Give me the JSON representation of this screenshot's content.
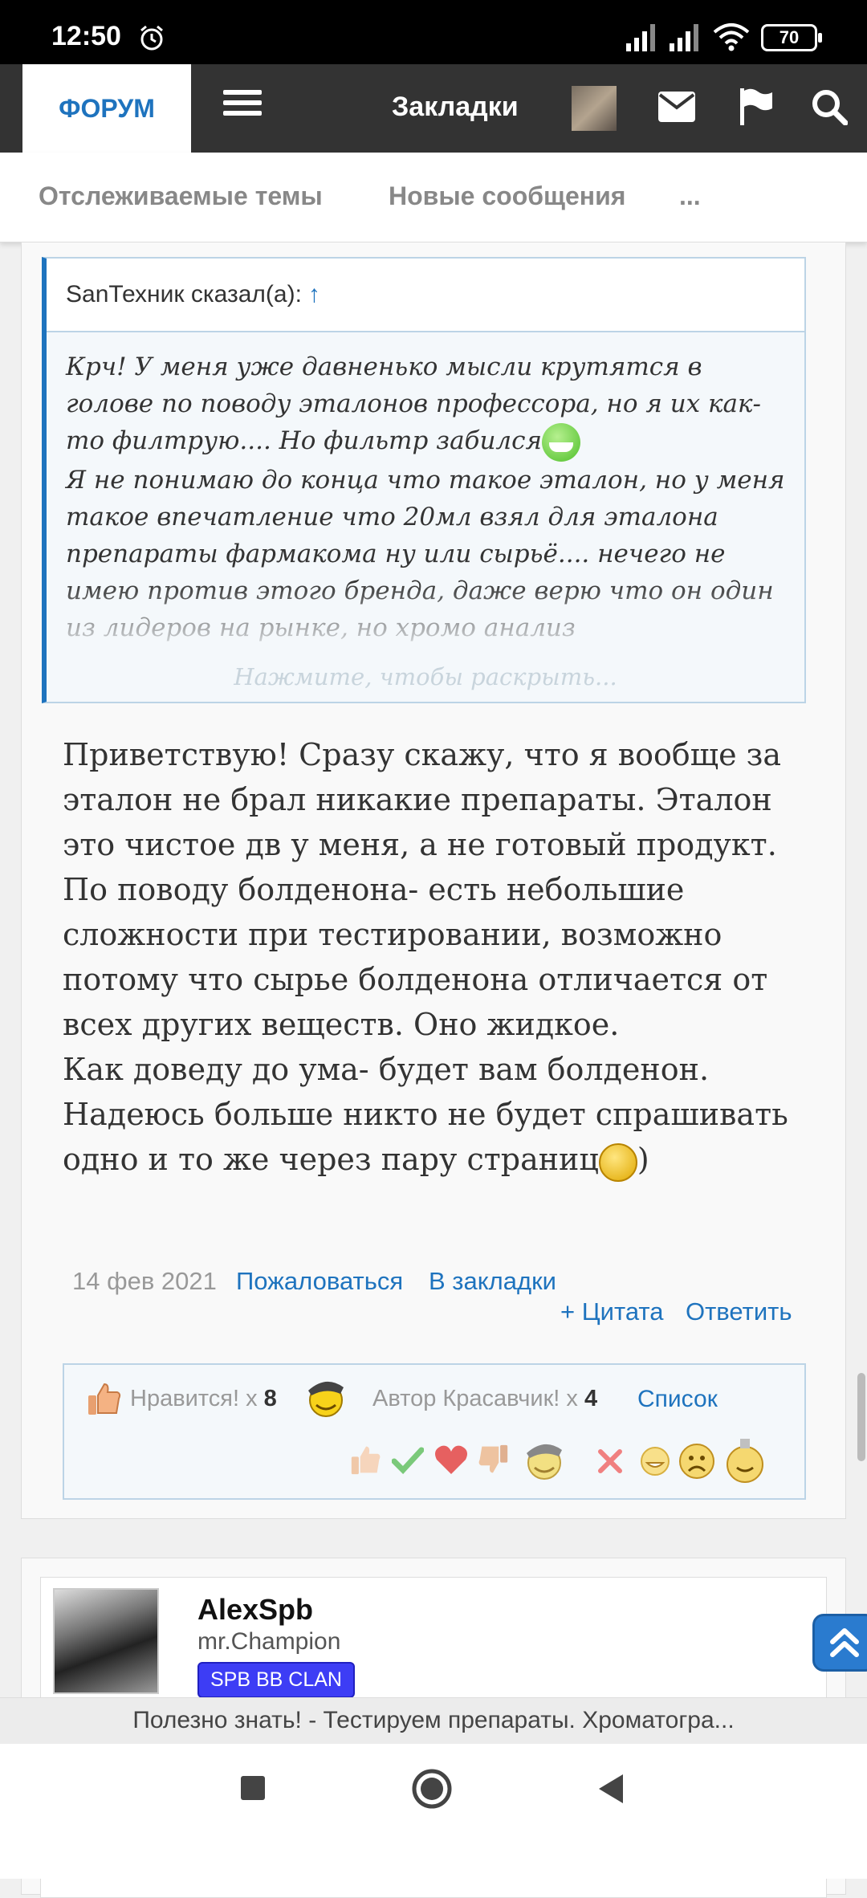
{
  "status_bar": {
    "time": "12:50",
    "battery": "70",
    "icons": [
      "alarm-icon",
      "signal-icon",
      "signal-icon",
      "wifi-icon",
      "battery-icon"
    ]
  },
  "navbar": {
    "active_tab": "ФОРУМ",
    "bookmarks": "Закладки",
    "icons": [
      "menu-icon",
      "avatar",
      "mail-icon",
      "flag-icon",
      "search-icon"
    ],
    "colors": {
      "bar": "#333333",
      "accent": "#1e73be"
    }
  },
  "subnav": {
    "items": [
      "Отслеживаемые темы",
      "Новые сообщения",
      "..."
    ]
  },
  "quote": {
    "author_line": "SanТехник сказал(а):",
    "jump_symbol": "↑",
    "text_part1": "Крч! У меня уже давненько мысли крутятся в голове по поводу эталонов профессора, но я их как-то филтрую.... Но фильтр забился",
    "text_part2": "Я не понимаю до конца что такое эталон, но у меня такое впечатление что 20мл взял для эталона препараты фармакома ну или сырьё.... нечего не имею против этого бренда, даже верю что он один из лидеров на рынке, но хромо анализ",
    "expand": "Нажмите, чтобы раскрыть..."
  },
  "post": {
    "text": "Приветствую! Сразу скажу, что я вообще за эталон не брал никакие препараты. Эталон это чистое дв у меня, а не готовый продукт.\nПо поводу болденона- есть небольшие сложности при тестировании, возможно потому что сырье болденона отличается от всех других веществ. Оно жидкое.\nКак доведу до ума- будет вам болденон.\nНадеюсь больше никто не будет спрашивать одно и то же через пару страниц",
    "text_end": ")",
    "date": "14 фев 2021",
    "report": "Пожаловаться",
    "bookmark": "В закладки",
    "quote_btn": "+ Цитата",
    "reply_btn": "Ответить"
  },
  "reactions": {
    "like_label": "Нравится! x",
    "like_count": "8",
    "author_label": "Автор Красавчик! x",
    "author_count": "4",
    "list_link": "Список",
    "palette": [
      "thumbs-up-icon",
      "check-icon",
      "heart-icon",
      "thumbs-down-icon",
      "cool-smiley-icon",
      "cross-icon",
      "grin-icon",
      "sad-icon",
      "medal-icon"
    ]
  },
  "next_post": {
    "username": "AlexSpb",
    "title": "mr.Champion",
    "badge": "SPB BB CLAN"
  },
  "bottom_bar": {
    "thread_title": "Полезно знать! - Тестируем препараты. Хроматогра..."
  }
}
